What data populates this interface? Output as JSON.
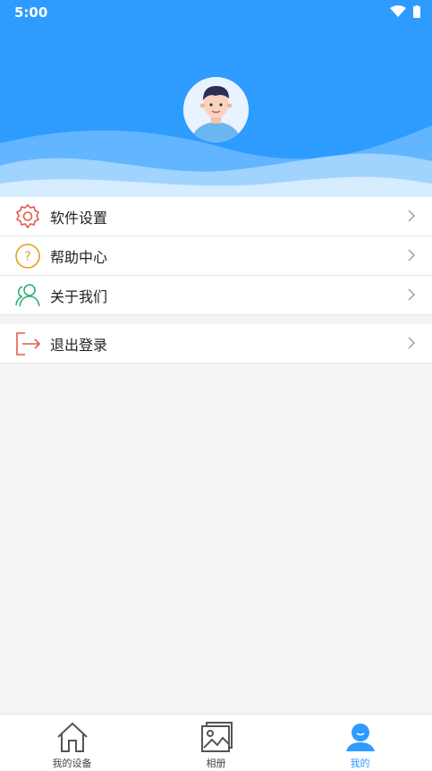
{
  "status_bar": {
    "time": "5:00"
  },
  "menu_group_1": [
    {
      "label": "软件设置",
      "icon": "gear-icon"
    },
    {
      "label": "帮助中心",
      "icon": "help-icon"
    },
    {
      "label": "关于我们",
      "icon": "users-icon"
    }
  ],
  "menu_group_2": [
    {
      "label": "退出登录",
      "icon": "logout-icon"
    }
  ],
  "tabbar": {
    "tabs": [
      {
        "label": "我的设备",
        "icon": "home-icon"
      },
      {
        "label": "相册",
        "icon": "album-icon"
      },
      {
        "label": "我的",
        "icon": "profile-icon"
      }
    ],
    "active_index": 2
  },
  "colors": {
    "primary": "#2e9bff",
    "gear": "#e25b4b",
    "help": "#e0a21b",
    "users": "#2bb07a",
    "logout": "#e25b4b"
  }
}
